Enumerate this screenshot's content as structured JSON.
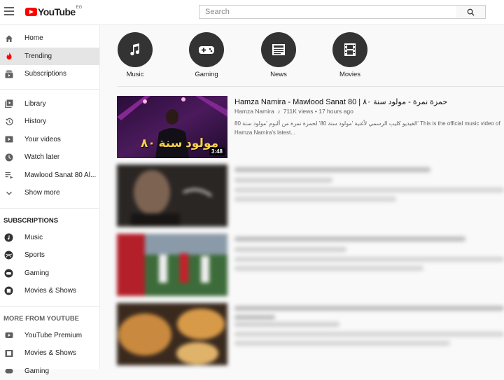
{
  "header": {
    "logo_text": "YouTube",
    "country_code": "EG",
    "search_placeholder": "Search"
  },
  "sidebar": {
    "nav": [
      {
        "label": "Home",
        "icon": "home-icon"
      },
      {
        "label": "Trending",
        "icon": "fire-icon",
        "active": true
      },
      {
        "label": "Subscriptions",
        "icon": "subscriptions-icon"
      }
    ],
    "library": [
      {
        "label": "Library",
        "icon": "library-icon"
      },
      {
        "label": "History",
        "icon": "history-icon"
      },
      {
        "label": "Your videos",
        "icon": "play-square-icon"
      },
      {
        "label": "Watch later",
        "icon": "clock-icon"
      },
      {
        "label": "Mawlood Sanat 80 Al...",
        "icon": "playlist-icon"
      },
      {
        "label": "Show more",
        "icon": "chevron-down-icon"
      }
    ],
    "subscriptions_heading": "SUBSCRIPTIONS",
    "subscriptions": [
      {
        "label": "Music",
        "icon": "music-icon"
      },
      {
        "label": "Sports",
        "icon": "sports-icon"
      },
      {
        "label": "Gaming",
        "icon": "gaming-icon"
      },
      {
        "label": "Movies & Shows",
        "icon": "movies-icon"
      }
    ],
    "more_heading": "MORE FROM YOUTUBE",
    "more": [
      {
        "label": "YouTube Premium",
        "icon": "youtube-icon"
      },
      {
        "label": "Movies & Shows",
        "icon": "film-icon"
      },
      {
        "label": "Gaming",
        "icon": "gamepad-icon"
      }
    ]
  },
  "categories": [
    {
      "label": "Music",
      "icon": "music-note-icon"
    },
    {
      "label": "Gaming",
      "icon": "gamepad-icon"
    },
    {
      "label": "News",
      "icon": "newspaper-icon"
    },
    {
      "label": "Movies",
      "icon": "film-strip-icon"
    }
  ],
  "videos": [
    {
      "title": "Hamza Namira - Mawlood Sanat 80 | حمزة نمرة - مولود سنة ٨٠",
      "channel": "Hamza Namira",
      "stats": "711K views • 17 hours ago",
      "description": "الفيديو كليب الرسمي لأغنية 'مولود سنة 80' لحمزة نمرة من ألبوم 'مولود سنة 80' This is the official music video of Hamza Namira's latest...",
      "duration": "3:48",
      "thumb_text": "مولود سنة ٨٠"
    }
  ],
  "colors": {
    "brand_red": "#ff0000",
    "active_bg": "#e5e5e5",
    "category_circle": "#333333"
  }
}
